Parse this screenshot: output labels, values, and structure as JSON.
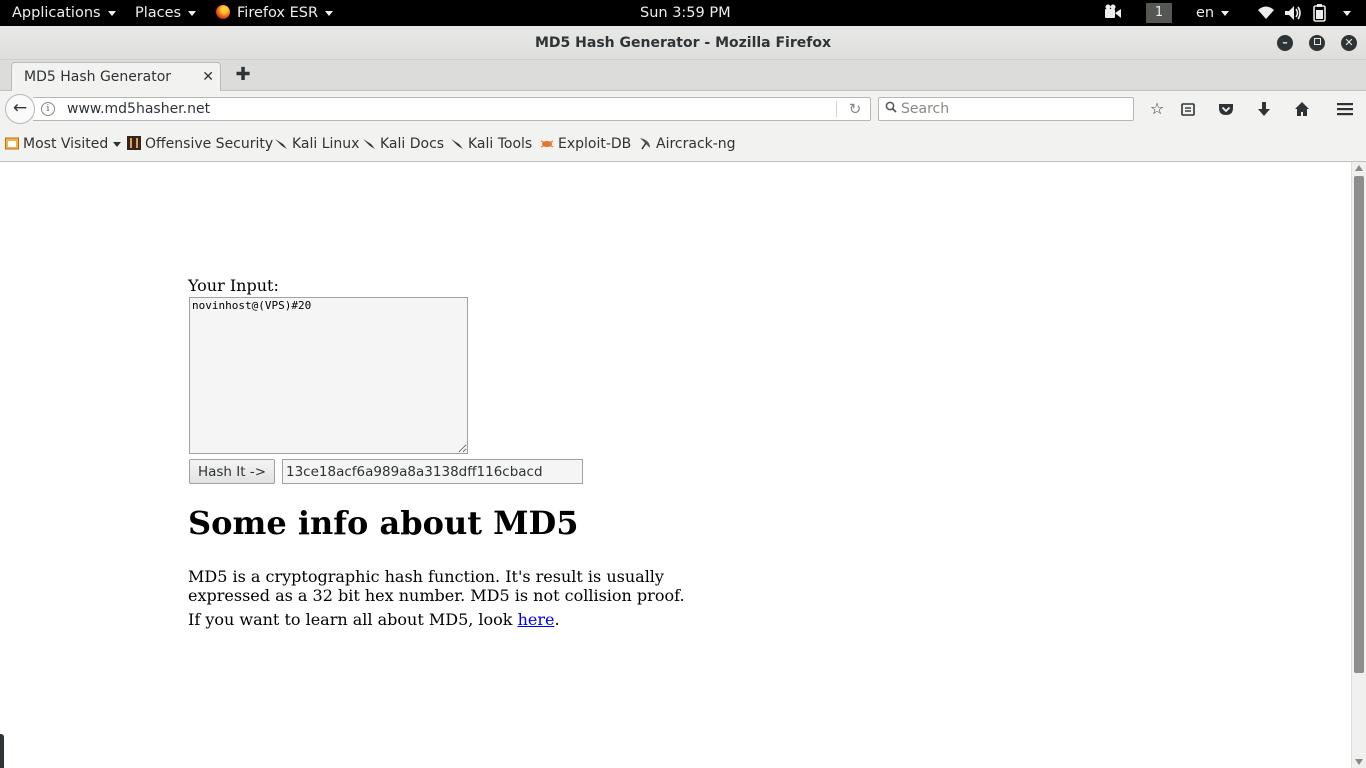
{
  "topbar": {
    "applications": "Applications",
    "places": "Places",
    "app_name": "Firefox ESR",
    "clock": "Sun  3:59 PM",
    "workspace": "1",
    "language": "en"
  },
  "window": {
    "title": "MD5 Hash Generator - Mozilla Firefox"
  },
  "tabs": [
    {
      "label": "MD5 Hash Generator",
      "close": "✕"
    }
  ],
  "new_tab": "✚",
  "navbar": {
    "url": "www.md5hasher.net",
    "search_placeholder": "Search"
  },
  "bookmarks": {
    "most_visited": "Most Visited",
    "items": [
      "Offensive Security",
      "Kali Linux",
      "Kali Docs",
      "Kali Tools",
      "Exploit-DB",
      "Aircrack-ng"
    ]
  },
  "page": {
    "input_label": "Your Input:",
    "input_value": "novinhost@(VPS)#20",
    "hash_button": "Hash It ->",
    "hash_output": "13ce18acf6a989a8a3138dff116cbacd",
    "info_heading": "Some info about MD5",
    "info_paragraph": "MD5 is a cryptographic hash function. It's result is usually expressed as a 32 bit hex number. MD5 is not collision proof.",
    "learn_prefix": "If you want to learn all about MD5, look ",
    "learn_link": "here",
    "learn_suffix": "."
  },
  "colors": {
    "topbar_bg": "#000000",
    "chrome_bg": "#f2f2f1",
    "link": "#0000ee"
  }
}
